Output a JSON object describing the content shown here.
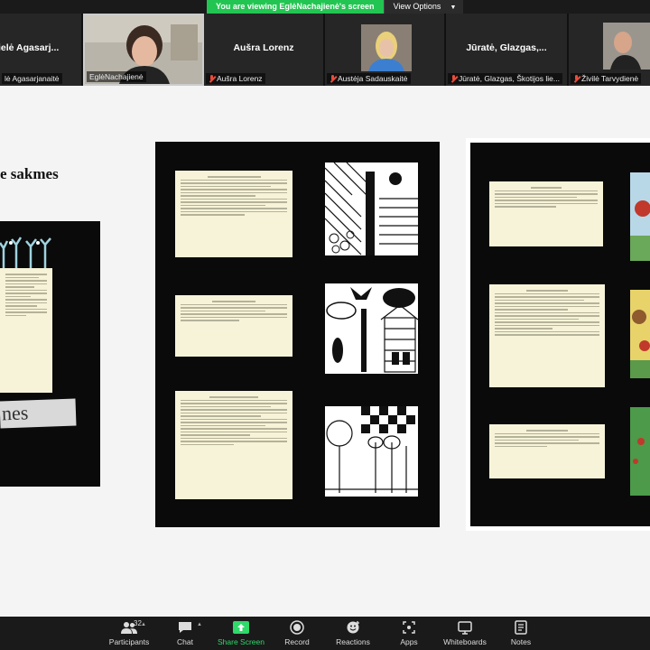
{
  "banner": {
    "message": "You are viewing EglėNachajienė's screen",
    "view_options": "View Options"
  },
  "participants": [
    {
      "big_name": "ielė  Agasarj...",
      "label": "lė Agasarjanaitė",
      "muted": false,
      "has_video": false
    },
    {
      "big_name": "",
      "label": "EglėNachajienė",
      "muted": false,
      "has_video": true,
      "active": true
    },
    {
      "big_name": "Aušra Lorenz",
      "label": "Aušra Lorenz",
      "muted": true,
      "has_video": false
    },
    {
      "big_name": "",
      "label": "Austėja Sadauskaitė",
      "muted": true,
      "has_video": true
    },
    {
      "big_name": "Jūratė,  Glazgas,...",
      "label": "Jūratė, Glazgas, Škotijos lie...",
      "muted": true,
      "has_video": false
    },
    {
      "big_name": "",
      "label": "Živilė Tarvydienė",
      "muted": true,
      "has_video": true
    }
  ],
  "slide": {
    "heading": "e sakmes",
    "poster_caption": "nes"
  },
  "toolbar": {
    "participants": {
      "label": "Participants",
      "count": "32",
      "icon": "participants-icon"
    },
    "chat": {
      "label": "Chat",
      "icon": "chat-icon"
    },
    "share": {
      "label": "Share Screen",
      "icon": "share-screen-icon"
    },
    "record": {
      "label": "Record",
      "icon": "record-icon"
    },
    "reactions": {
      "label": "Reactions",
      "icon": "reactions-icon"
    },
    "apps": {
      "label": "Apps",
      "icon": "apps-icon"
    },
    "whiteboards": {
      "label": "Whiteboards",
      "icon": "whiteboards-icon"
    },
    "notes": {
      "label": "Notes",
      "icon": "notes-icon"
    }
  },
  "colors": {
    "banner_green": "#23c552",
    "toolbar_bg": "#1a1a1a",
    "share_green": "#2fd96a",
    "muted_red": "#e74c3c"
  }
}
